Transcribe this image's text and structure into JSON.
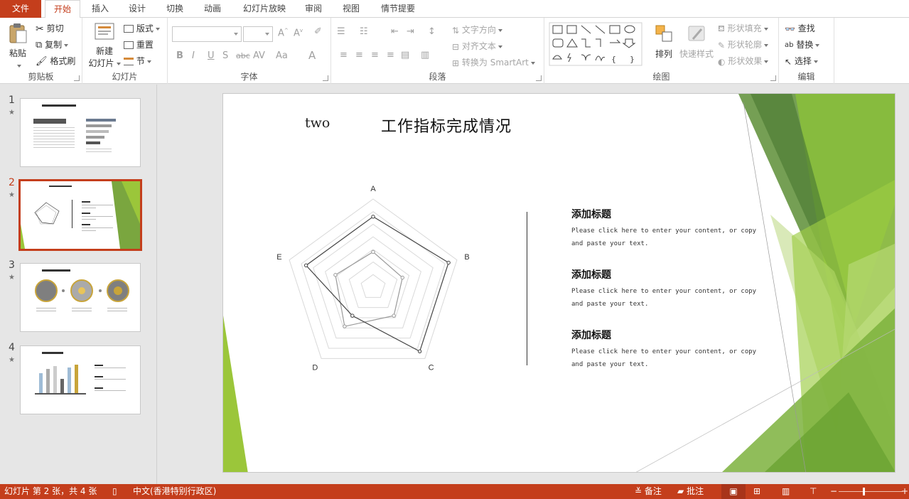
{
  "tabs": [
    "文件",
    "开始",
    "插入",
    "设计",
    "切换",
    "动画",
    "幻灯片放映",
    "审阅",
    "视图",
    "情节提要"
  ],
  "ribbon": {
    "clipboard": {
      "label": "剪贴板",
      "paste": "粘贴",
      "cut": "剪切",
      "copy": "复制",
      "format_painter": "格式刷"
    },
    "slides": {
      "label": "幻灯片",
      "new_slide_1": "新建",
      "new_slide_2": "幻灯片",
      "layout": "版式",
      "reset": "重置",
      "section": "节"
    },
    "font": {
      "label": "字体"
    },
    "paragraph": {
      "label": "段落",
      "text_direction": "文字方向",
      "align_text": "对齐文本",
      "convert_smartart": "转换为 SmartArt"
    },
    "drawing": {
      "label": "绘图",
      "arrange": "排列",
      "quick_styles": "快速样式",
      "shape_fill": "形状填充",
      "shape_outline": "形状轮廓",
      "shape_effects": "形状效果"
    },
    "editing": {
      "label": "编辑",
      "find": "查找",
      "replace": "替换",
      "select": "选择"
    }
  },
  "thumbnails": [
    {
      "num": "1",
      "star": "★"
    },
    {
      "num": "2",
      "star": "★"
    },
    {
      "num": "3",
      "star": "★"
    },
    {
      "num": "4",
      "star": "★"
    }
  ],
  "slide": {
    "tag": "two",
    "title": "工作指标完成情况",
    "radar_labels": [
      "A",
      "B",
      "C",
      "D",
      "E"
    ],
    "radar_series_outer": [
      0.8,
      0.9,
      0.9,
      0.4,
      0.8
    ],
    "radar_series_inner": [
      0.4,
      0.35,
      0.4,
      0.55,
      0.45
    ],
    "blocks": [
      {
        "heading": "添加标题",
        "body": "Please click here to enter your content, or copy and paste your text."
      },
      {
        "heading": "添加标题",
        "body": "Please click here to enter your content, or copy and paste your text."
      },
      {
        "heading": "添加标题",
        "body": "Please click here to enter your content, or copy and paste your text."
      }
    ]
  },
  "status": {
    "slide_info": "幻灯片 第 2 张，共 4 张",
    "language": "中文(香港特别行政区)",
    "notes": "备注",
    "comments": "批注"
  },
  "colors": {
    "accent": "#c43e1c",
    "green_dark": "#5a8a3a",
    "green_light": "#9bc63a"
  }
}
